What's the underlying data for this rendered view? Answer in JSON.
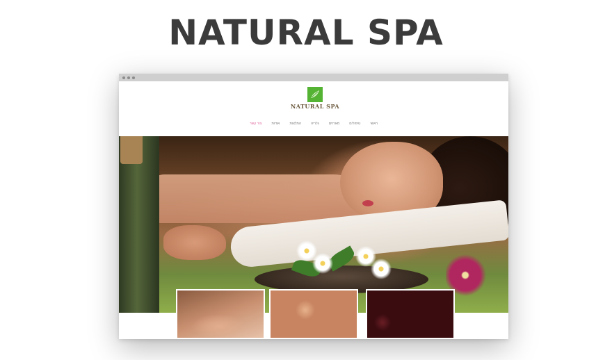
{
  "page": {
    "title": "NATURAL SPA"
  },
  "site": {
    "logo_text": "NATURAL SPA",
    "brand_color": "#55b334",
    "nav": {
      "items": [
        {
          "label": "ראשי",
          "active": false
        },
        {
          "label": "טיפולים",
          "active": false
        },
        {
          "label": "מארזים",
          "active": false
        },
        {
          "label": "גלריה",
          "active": false
        },
        {
          "label": "המלצות",
          "active": false
        },
        {
          "label": "אודות",
          "active": false
        },
        {
          "label": "צור קשר",
          "active": true
        }
      ],
      "active_color": "#e06a9e"
    }
  },
  "hero": {
    "image": "spa-woman-massage-photo"
  },
  "thumbnails": [
    {
      "image": "massage-hands-photo"
    },
    {
      "image": "bath-flowers-photo"
    },
    {
      "image": "facial-treatment-photo"
    }
  ]
}
